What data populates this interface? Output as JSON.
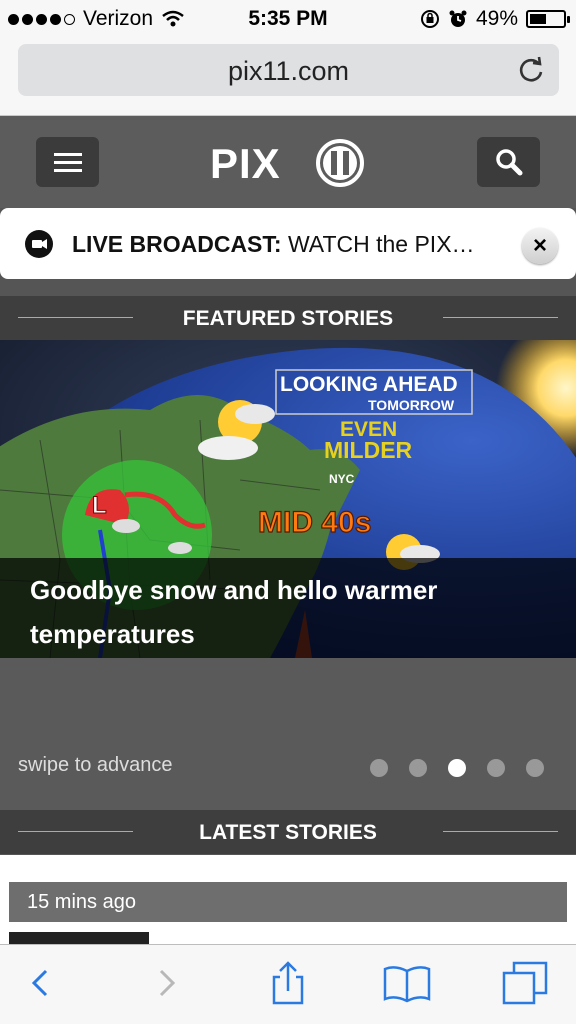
{
  "status_bar": {
    "carrier": "Verizon",
    "time": "5:35 PM",
    "battery": "49%",
    "battery_level": 0.49
  },
  "browser": {
    "url": "pix11.com"
  },
  "site_header": {
    "logo_text": "PIX11"
  },
  "live_banner": {
    "label": "LIVE BROADCAST:",
    "text": "WATCH the PIX…",
    "close_label": "×"
  },
  "featured": {
    "title": "FEATURED STORIES",
    "slide": {
      "headline": "Goodbye snow and hello warmer temperatures",
      "image_text": {
        "looking_ahead": "LOOKING AHEAD",
        "tomorrow": "TOMORROW",
        "even": "EVEN",
        "milder": "MILDER",
        "nyc": "NYC",
        "mid_40s": "MID 40s"
      }
    },
    "swipe_hint": "swipe to advance",
    "pager": {
      "count": 5,
      "active": 3
    }
  },
  "latest": {
    "title": "LATEST STORIES",
    "first_item_time": "15 mins ago"
  },
  "colors": {
    "accent_blue": "#2a7ae2",
    "header_bg": "#5c5c5c",
    "section_bg": "#3e3e3e"
  },
  "toolbar": {
    "icons": [
      "back-icon",
      "forward-icon",
      "share-icon",
      "bookmarks-icon",
      "tabs-icon"
    ]
  }
}
